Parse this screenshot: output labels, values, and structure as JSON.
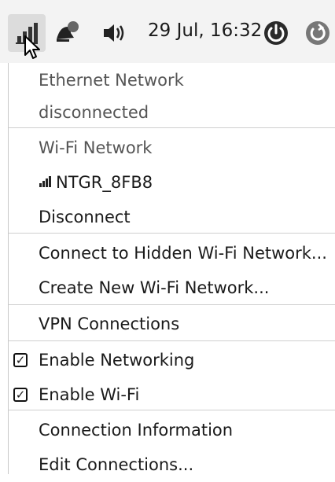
{
  "panel": {
    "clock": "29 Jul, 16:32",
    "icons": [
      "network-icon",
      "notification-icon",
      "volume-icon",
      "power-icon",
      "refresh-icon"
    ]
  },
  "menu": {
    "ethernet_header": "Ethernet Network",
    "ethernet_status": "disconnected",
    "wifi_header": "Wi-Fi Network",
    "wifi_ssid": "NTGR_8FB8",
    "disconnect": "Disconnect",
    "connect_hidden": "Connect to Hidden Wi-Fi Network...",
    "create_new": "Create New Wi-Fi Network...",
    "vpn": "VPN Connections",
    "enable_networking": "Enable Networking",
    "enable_networking_checked": true,
    "enable_wifi": "Enable Wi-Fi",
    "enable_wifi_checked": true,
    "connection_info": "Connection Information",
    "edit_connections": "Edit Connections..."
  }
}
